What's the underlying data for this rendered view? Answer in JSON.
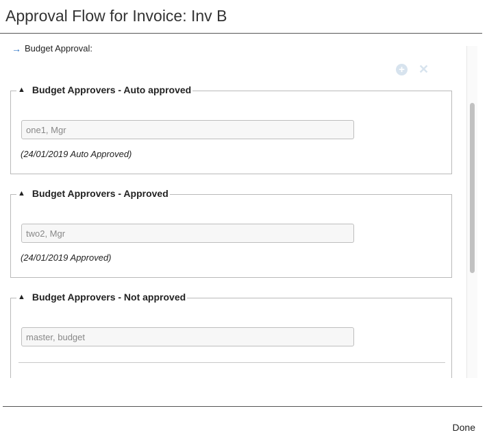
{
  "dialog": {
    "title": "Approval Flow for Invoice: Inv B"
  },
  "section": {
    "arrow_icon": "→",
    "label": "Budget Approval:"
  },
  "actions": {
    "add_icon": "+",
    "remove_icon": "✕"
  },
  "groups": [
    {
      "legend": "Budget Approvers - Auto approved",
      "toggle_icon": "▲",
      "approver_value": "one1, Mgr",
      "status": "(24/01/2019 Auto Approved)"
    },
    {
      "legend": "Budget Approvers - Approved",
      "toggle_icon": "▲",
      "approver_value": "two2, Mgr",
      "status": "(24/01/2019 Approved)"
    },
    {
      "legend": "Budget Approvers - Not approved",
      "toggle_icon": "▲",
      "approver_value": "master, budget"
    }
  ],
  "footer": {
    "done_label": "Done"
  },
  "colors": {
    "accent": "#2a73c5",
    "action_icon": "#d7e3ee"
  }
}
